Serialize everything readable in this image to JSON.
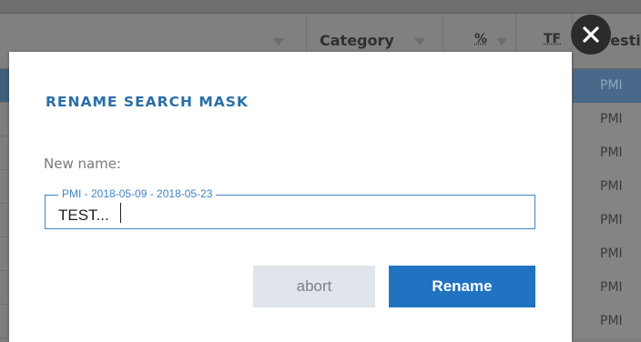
{
  "background": {
    "columns": {
      "category": "Category",
      "percent": "%",
      "tf": "TF",
      "destination": "Desti"
    },
    "rows": [
      {
        "destination": "PMI",
        "highlighted": true
      },
      {
        "destination": "PMI",
        "highlighted": false
      },
      {
        "destination": "PMI",
        "highlighted": false
      },
      {
        "destination": "PMI",
        "highlighted": false
      },
      {
        "destination": "PMI",
        "highlighted": false
      },
      {
        "destination": "PMI",
        "highlighted": false
      },
      {
        "destination": "PMI",
        "highlighted": false
      },
      {
        "destination": "PMI",
        "highlighted": false
      }
    ]
  },
  "dialog": {
    "title": "RENAME SEARCH MASK",
    "field_label": "New name:",
    "input": {
      "legend": "PMI - 2018-05-09 - 2018-05-23",
      "value": "TEST..."
    },
    "buttons": {
      "abort_label": "abort",
      "rename_label": "Rename"
    }
  },
  "colors": {
    "accent": "#2a6fa8",
    "primary_button": "#1f73c1",
    "secondary_button": "#dfe5ea"
  },
  "icons": {
    "close": "close-icon",
    "filter": "filter-icon"
  }
}
